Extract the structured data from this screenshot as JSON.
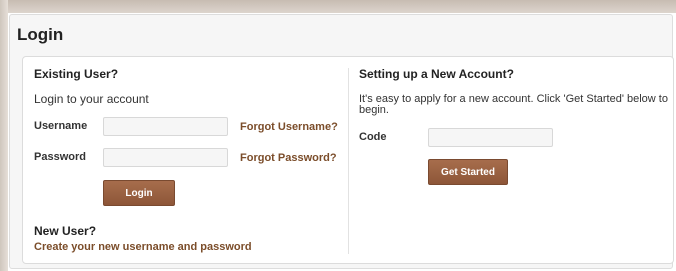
{
  "page": {
    "title": "Login"
  },
  "existing_user": {
    "heading": "Existing User?",
    "subheading": "Login to your account",
    "username_label": "Username",
    "username_value": "",
    "password_label": "Password",
    "password_value": "",
    "forgot_username": "Forgot Username?",
    "forgot_password": "Forgot Password?",
    "login_button": "Login"
  },
  "new_user": {
    "heading": "New User?",
    "create_link": "Create your new username and password"
  },
  "new_account": {
    "heading": "Setting up a New Account?",
    "description": "It's easy to apply for a new account. Click 'Get Started' below to begin.",
    "code_label": "Code",
    "code_value": "",
    "get_started_button": "Get Started"
  },
  "colors": {
    "button": "#995f41",
    "link": "#7b4d2a",
    "frame": "#d5cbc2"
  }
}
